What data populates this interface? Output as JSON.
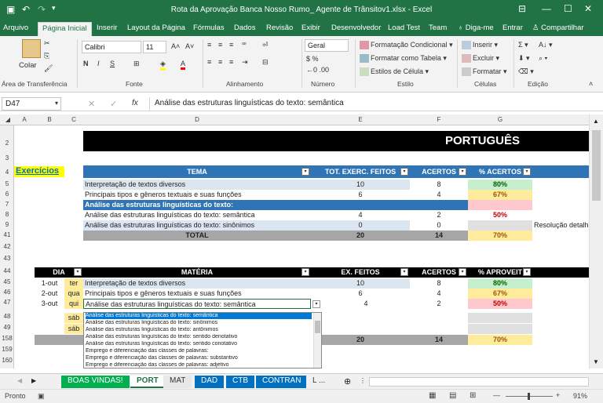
{
  "title": "Rota da Aprovação Banca Nosso Rumo_ Agente de Trânsitov1.xlsx - Excel",
  "tabs": [
    "Arquivo",
    "Página Inicial",
    "Inserir",
    "Layout da Página",
    "Fórmulas",
    "Dados",
    "Revisão",
    "Exibir",
    "Desenvolvedor",
    "Load Test",
    "Team",
    "Diga-me",
    "Entrar",
    "Compartilhar"
  ],
  "ribbon": {
    "paste": "Colar",
    "clipboard": "Área de Transferência",
    "font_name": "Calibri",
    "font_size": "11",
    "font": "Fonte",
    "alignment": "Alinhamento",
    "number_format": "Geral",
    "number": "Número",
    "cond_format": "Formatação Condicional",
    "format_table": "Formatar como Tabela",
    "cell_styles": "Estilos de Célula",
    "styles": "Estilo",
    "insert": "Inserir",
    "delete": "Excluir",
    "format": "Formatar",
    "cells": "Células",
    "editing": "Edição",
    "bold": "N",
    "italic": "I",
    "underline": "S"
  },
  "namebox": "D47",
  "formula": "Análise das estruturas linguísticas do texto: semântica",
  "columns": [
    "A",
    "B",
    "C",
    "D",
    "E",
    "F",
    "G"
  ],
  "rows": [
    "2",
    "3",
    "4",
    "5",
    "6",
    "7",
    "8",
    "9",
    "41",
    "42",
    "43",
    "44",
    "45",
    "46",
    "47",
    "48",
    "49",
    "158",
    "159",
    "160"
  ],
  "header_title": "PORTUGUÊS",
  "exercicios": "Exercícios",
  "table1": {
    "headers": [
      "TEMA",
      "TOT. EXERC. FEITOS",
      "ACERTOS",
      "% ACERTOS"
    ],
    "rows": [
      [
        "Interpretação de textos diversos",
        "10",
        "8",
        "80%"
      ],
      [
        "Principais tipos e gêneros textuais e suas funções",
        "6",
        "4",
        "67%"
      ],
      [
        "Análise das estruturas linguísticas do texto:",
        "",
        "",
        ""
      ],
      [
        "Análise das estruturas linguísticas do texto: semântica",
        "4",
        "2",
        "50%"
      ],
      [
        "Análise das estruturas linguísticas do texto: sinônimos",
        "0",
        "0",
        ""
      ]
    ],
    "total": [
      "TOTAL",
      "20",
      "14",
      "70%"
    ],
    "note": "Resolução detalh"
  },
  "table2": {
    "headers": [
      "DIA",
      "MATÉRIA",
      "EX. FEITOS",
      "ACERTOS",
      "% APROVEIT"
    ],
    "rows": [
      [
        "1-out",
        "ter",
        "Interpretação de textos diversos",
        "10",
        "8",
        "80%"
      ],
      [
        "2-out",
        "qua",
        "Principais tipos e gêneros textuais e suas funções",
        "6",
        "4",
        "67%"
      ],
      [
        "3-out",
        "qui",
        "Análise das estruturas linguísticas do texto: semântica",
        "4",
        "2",
        "50%"
      ],
      [
        "",
        "sáb",
        "",
        "",
        "",
        ""
      ],
      [
        "",
        "sáb",
        "",
        "",
        "",
        ""
      ]
    ],
    "total": [
      "20",
      "14",
      "70%"
    ]
  },
  "dropdown_items": [
    "Análise das estruturas linguísticas do texto: semântica",
    "Análise das estruturas linguísticas do texto: sinônimos",
    "Análise das estruturas linguísticas do texto: antônimos",
    "Análise das estruturas linguísticas do texto: sentido denotativo",
    "Análise das estruturas linguísticas do texto: sentido conotativo",
    "Emprego e diferenciação das classes de palavras:",
    "Emprego e diferenciação das classes de palavras: substantivo",
    "Emprego e diferenciação das classes de palavras: adjetivo"
  ],
  "sheets": [
    "BOAS VINDAS!",
    "PORT",
    "MAT",
    "DAD",
    "CTB",
    "CONTRAN",
    "L ..."
  ],
  "status": "Pronto",
  "zoom": "91%",
  "colors": {
    "excel_green": "#217346",
    "header_blue": "#2f75b5",
    "black": "#000000",
    "light_blue": "#dce6f1",
    "green_fill": "#c6efce",
    "yellow_fill": "#ffeb9c",
    "red_fill": "#ffc7ce",
    "grey": "#a6a6a6"
  }
}
